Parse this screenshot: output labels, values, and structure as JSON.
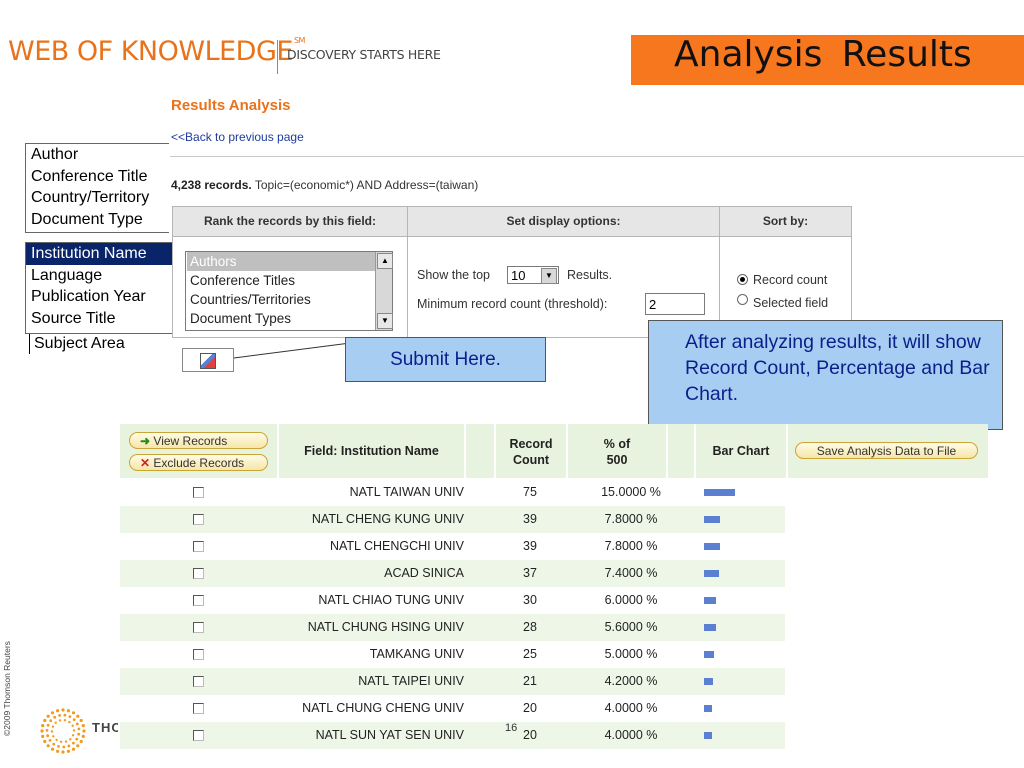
{
  "header": {
    "logo": "WEB OF KNOWLEDGE",
    "logo_mark": "SM",
    "tagline": "DISCOVERY STARTS HERE",
    "slide_title": "Analysis  Results"
  },
  "page": {
    "heading": "Results Analysis",
    "back_link": "<<Back to previous page",
    "records_count": "4,238 records.",
    "query": " Topic=(economic*) AND Address=(taiwan)"
  },
  "field_list_top": [
    "Author",
    "Conference Title",
    "Country/Territory",
    "Document Type"
  ],
  "field_list_bottom": [
    "Institution Name",
    "Language",
    "Publication Year",
    "Source Title"
  ],
  "field_list_subject": "Subject Area",
  "options": {
    "rank_header": "Rank the records by this field:",
    "display_header": "Set display options:",
    "sort_header": "Sort by:",
    "rank_items": [
      "Authors",
      "Conference Titles",
      "Countries/Territories",
      "Document Types"
    ],
    "show_top_prefix": "Show the top",
    "show_top_value": "10",
    "show_top_suffix": "Results.",
    "threshold_label": "Minimum record count (threshold):",
    "threshold_value": "2",
    "sort_record_count": "Record count",
    "sort_selected_field": "Selected field"
  },
  "callouts": {
    "submit": "Submit Here.",
    "info": "After analyzing results, it will show Record Count, Percentage and Bar Chart."
  },
  "results": {
    "view_records": "View Records",
    "exclude_records": "Exclude Records",
    "field_header": "Field: Institution Name",
    "count_header_1": "Record",
    "count_header_2": "Count",
    "pct_header_1": "% of",
    "pct_header_2": "500",
    "bar_header": "Bar Chart",
    "save_button": "Save Analysis Data to File",
    "rows": [
      {
        "name": "NATL TAIWAN UNIV",
        "count": "75",
        "pct": "15.0000 %",
        "share": 15.0
      },
      {
        "name": "NATL CHENG KUNG UNIV",
        "count": "39",
        "pct": "7.8000 %",
        "share": 7.8
      },
      {
        "name": "NATL CHENGCHI UNIV",
        "count": "39",
        "pct": "7.8000 %",
        "share": 7.8
      },
      {
        "name": "ACAD SINICA",
        "count": "37",
        "pct": "7.4000 %",
        "share": 7.4
      },
      {
        "name": "NATL CHIAO TUNG UNIV",
        "count": "30",
        "pct": "6.0000 %",
        "share": 6.0
      },
      {
        "name": "NATL CHUNG HSING UNIV",
        "count": "28",
        "pct": "5.6000 %",
        "share": 5.6
      },
      {
        "name": "TAMKANG UNIV",
        "count": "25",
        "pct": "5.0000 %",
        "share": 5.0
      },
      {
        "name": "NATL TAIPEI UNIV",
        "count": "21",
        "pct": "4.2000 %",
        "share": 4.2
      },
      {
        "name": "NATL CHUNG CHENG UNIV",
        "count": "20",
        "pct": "4.0000 %",
        "share": 4.0
      },
      {
        "name": "NATL SUN YAT SEN UNIV",
        "count": "20",
        "pct": "4.0000 %",
        "share": 4.0
      }
    ]
  },
  "footer": {
    "page_number": "16",
    "copyright": "©2009 Thomson Reuters",
    "company": "THOMSON REUTERS"
  },
  "colors": {
    "brand_orange": "#f7771f",
    "callout_blue": "#a8cdf2",
    "bar_blue": "#5b7fd1",
    "row_green": "#eef6e8"
  }
}
